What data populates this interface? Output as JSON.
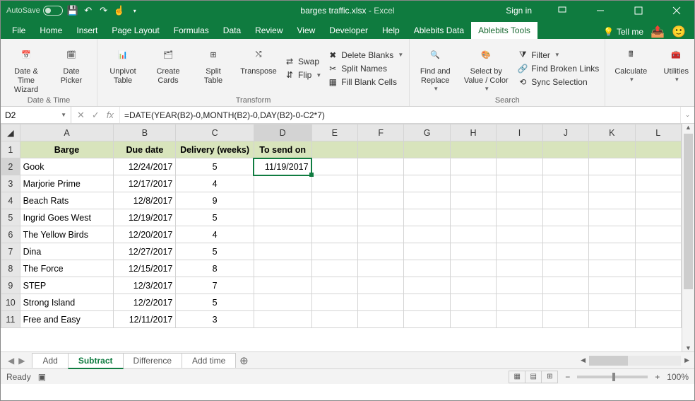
{
  "titlebar": {
    "autosave_label": "AutoSave",
    "autosave_state": "Off",
    "filename": "barges traffic.xlsx",
    "app_suffix": " - Excel",
    "signin": "Sign in"
  },
  "tabs": {
    "file": "File",
    "items": [
      "Home",
      "Insert",
      "Page Layout",
      "Formulas",
      "Data",
      "Review",
      "View",
      "Developer",
      "Help",
      "Ablebits Data",
      "Ablebits Tools"
    ],
    "active": "Ablebits Tools",
    "tellme": "Tell me"
  },
  "ribbon": {
    "date_time": {
      "btn1": "Date &\nTime Wizard",
      "btn2": "Date\nPicker",
      "label": "Date & Time"
    },
    "transform": {
      "btn1": "Unpivot\nTable",
      "btn2": "Create\nCards",
      "btn3": "Split\nTable",
      "btn4": "Transpose",
      "s1": "Swap",
      "s2": "Flip",
      "s3": "Delete Blanks",
      "s4": "Split Names",
      "s5": "Fill Blank Cells",
      "label": "Transform"
    },
    "search": {
      "btn1": "Find and\nReplace",
      "btn2": "Select by\nValue / Color",
      "s1": "Filter",
      "s2": "Find Broken Links",
      "s3": "Sync Selection",
      "label": "Search"
    },
    "right": {
      "btn1": "Calculate",
      "btn2": "Utilities"
    }
  },
  "formula": {
    "namebox": "D2",
    "text": "=DATE(YEAR(B2)-0,MONTH(B2)-0,DAY(B2)-0-C2*7)"
  },
  "columns": [
    "A",
    "B",
    "C",
    "D",
    "E",
    "F",
    "G",
    "H",
    "I",
    "J",
    "K",
    "L"
  ],
  "headers": {
    "A": "Barge",
    "B": "Due date",
    "C": "Delivery (weeks)",
    "D": "To send on"
  },
  "rows": [
    {
      "n": 2,
      "A": "Gook",
      "B": "12/24/2017",
      "C": "5",
      "D": "11/19/2017"
    },
    {
      "n": 3,
      "A": "Marjorie Prime",
      "B": "12/17/2017",
      "C": "4",
      "D": ""
    },
    {
      "n": 4,
      "A": "Beach Rats",
      "B": "12/8/2017",
      "C": "9",
      "D": ""
    },
    {
      "n": 5,
      "A": "Ingrid Goes West",
      "B": "12/19/2017",
      "C": "5",
      "D": ""
    },
    {
      "n": 6,
      "A": "The Yellow Birds",
      "B": "12/20/2017",
      "C": "4",
      "D": ""
    },
    {
      "n": 7,
      "A": "Dina",
      "B": "12/27/2017",
      "C": "5",
      "D": ""
    },
    {
      "n": 8,
      "A": "The Force",
      "B": "12/15/2017",
      "C": "8",
      "D": ""
    },
    {
      "n": 9,
      "A": "STEP",
      "B": "12/3/2017",
      "C": "7",
      "D": ""
    },
    {
      "n": 10,
      "A": "Strong Island",
      "B": "12/2/2017",
      "C": "5",
      "D": ""
    },
    {
      "n": 11,
      "A": "Free and Easy",
      "B": "12/11/2017",
      "C": "3",
      "D": ""
    }
  ],
  "sheets": {
    "items": [
      "Add",
      "Subtract",
      "Difference",
      "Add time"
    ],
    "active": "Subtract"
  },
  "status": {
    "ready": "Ready",
    "zoom": "100%"
  }
}
